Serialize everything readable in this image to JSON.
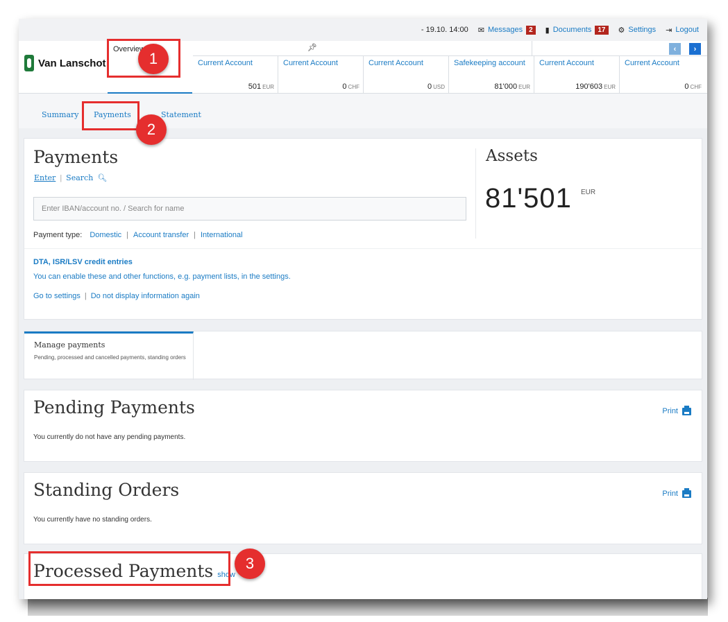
{
  "topbar": {
    "datetime": "- 19.10. 14:00",
    "messages_label": "Messages",
    "messages_count": "2",
    "documents_label": "Documents",
    "documents_count": "17",
    "settings_label": "Settings",
    "logout_label": "Logout"
  },
  "brand": {
    "name": "Van Lanschot"
  },
  "overview_tab": {
    "label": "Overview"
  },
  "accounts": [
    {
      "name": "Current Account",
      "amount": "501",
      "currency": "EUR"
    },
    {
      "name": "Current Account",
      "amount": "0",
      "currency": "CHF"
    },
    {
      "name": "Current Account",
      "amount": "0",
      "currency": "USD"
    },
    {
      "name": "Safekeeping account",
      "amount": "81'000",
      "currency": "EUR"
    },
    {
      "name": "Current Account",
      "amount": "190'603",
      "currency": "EUR"
    },
    {
      "name": "Current Account",
      "amount": "0",
      "currency": "CHF"
    }
  ],
  "subnav": {
    "summary": "Summary",
    "payments": "Payments",
    "statement": "Statement"
  },
  "payments": {
    "title": "Payments",
    "mode_enter": "Enter",
    "mode_search": "Search",
    "input_placeholder": "Enter IBAN/account no. / Search for name",
    "payment_type_label": "Payment type:",
    "type_domestic": "Domestic",
    "type_account_transfer": "Account transfer",
    "type_international": "International",
    "dta_title": "DTA, ISR/LSV credit entries",
    "dta_text": "You can enable these and other functions, e.g. payment lists, in the settings.",
    "go_to_settings": "Go to settings",
    "do_not_display": "Do not display information again"
  },
  "assets": {
    "title": "Assets",
    "value": "81'501",
    "currency": "EUR"
  },
  "manage": {
    "title": "Manage payments",
    "description": "Pending, processed and cancelled payments, standing orders"
  },
  "pending": {
    "title": "Pending Payments",
    "text": "You currently do not have any pending payments.",
    "print": "Print"
  },
  "standing": {
    "title": "Standing Orders",
    "text": "You currently have no standing orders.",
    "print": "Print"
  },
  "processed": {
    "title": "Processed Payments",
    "show": "show"
  },
  "annotations": {
    "marker1": "1",
    "marker2": "2",
    "marker3": "3",
    "highlight_color": "#e52e2e"
  },
  "colors": {
    "accent": "#1a7bc4",
    "badge": "#b3261e",
    "brand_green": "#1f7a3a"
  }
}
